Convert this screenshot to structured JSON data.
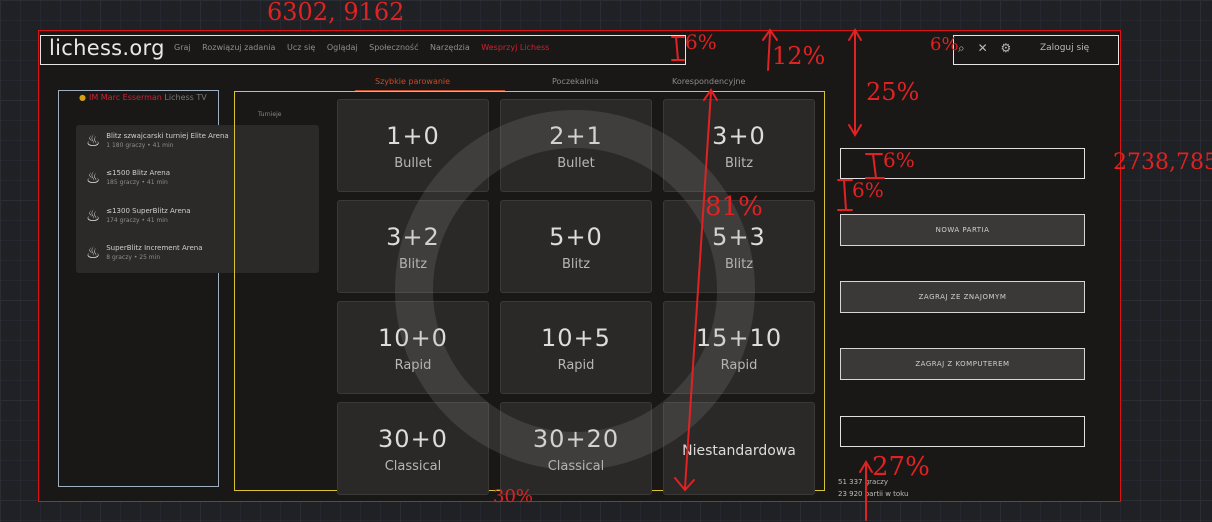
{
  "header": {
    "logo": "lichess.org",
    "nav": [
      "Graj",
      "Rozwiązuj zadania",
      "Ucz się",
      "Oglądaj",
      "Społeczność",
      "Narzędzia",
      "Wesprzyj Lichess"
    ],
    "icons": [
      "search-icon",
      "swords-icon",
      "gear-icon"
    ],
    "signin": "Zaloguj się"
  },
  "tabs": {
    "quick": "Szybkie parowanie",
    "lobby": "Poczekalnia",
    "correspondence": "Korespondencyjne"
  },
  "sidebar": {
    "tv_live": "Lichess TV",
    "tv_player": "IM Marc Esserman",
    "small_link": "Turnieje",
    "tournaments": [
      {
        "name": "Blitz szwajcarski turniej Elite Arena",
        "meta": "1 180 graczy • 41 min"
      },
      {
        "name": "≤1500 Blitz Arena",
        "meta": "185 graczy • 41 min"
      },
      {
        "name": "≤1300 SuperBlitz Arena",
        "meta": "174 graczy • 41 min"
      },
      {
        "name": "SuperBlitz Increment Arena",
        "meta": "8 graczy • 25 min"
      }
    ]
  },
  "pools": [
    {
      "clock": "1+0",
      "perf": "Bullet"
    },
    {
      "clock": "2+1",
      "perf": "Bullet"
    },
    {
      "clock": "3+0",
      "perf": "Blitz"
    },
    {
      "clock": "3+2",
      "perf": "Blitz"
    },
    {
      "clock": "5+0",
      "perf": "Blitz"
    },
    {
      "clock": "5+3",
      "perf": "Blitz"
    },
    {
      "clock": "10+0",
      "perf": "Rapid"
    },
    {
      "clock": "10+5",
      "perf": "Rapid"
    },
    {
      "clock": "15+10",
      "perf": "Rapid"
    },
    {
      "clock": "30+0",
      "perf": "Classical"
    },
    {
      "clock": "30+20",
      "perf": "Classical"
    },
    {
      "clock": "Niestandardowa",
      "perf": ""
    }
  ],
  "actions": {
    "new_game": "NOWA PARTIA",
    "play_friend": "ZAGRAJ ZE ZNAJOMYM",
    "play_computer": "ZAGRAJ Z KOMPUTEREM"
  },
  "stats": {
    "players": "51 337 graczy",
    "games": "23 920 partii w toku"
  },
  "annotations": {
    "top_coords": "6302, 9162",
    "right_coords": "2738,785",
    "pct_header": "6%",
    "pct_12": "12%",
    "pct_25": "25%",
    "pct_right": "6%",
    "pct_6_box": "6%",
    "pct_6_left": "6%",
    "pct_81": "81%",
    "pct_bottom": "30%",
    "pct_27": "27%"
  },
  "colors": {
    "accent_orange": "#c84b2a",
    "annotation_red": "#e02222",
    "yellow_frame": "#d6c435",
    "blue_frame": "#9eb0c0"
  }
}
